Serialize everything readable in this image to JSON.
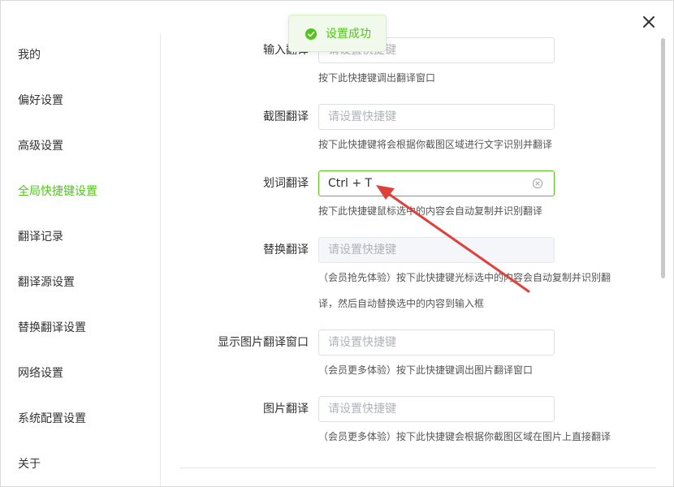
{
  "colors": {
    "accent": "#52c41a",
    "arrow": "#e0403a"
  },
  "sidebar": {
    "items": [
      {
        "label": "我的"
      },
      {
        "label": "偏好设置"
      },
      {
        "label": "高级设置"
      },
      {
        "label": "全局快捷键设置",
        "active": true
      },
      {
        "label": "翻译记录"
      },
      {
        "label": "翻译源设置"
      },
      {
        "label": "替换翻译设置"
      },
      {
        "label": "网络设置"
      },
      {
        "label": "系统配置设置"
      },
      {
        "label": "关于"
      }
    ]
  },
  "shortcuts": [
    {
      "label": "输入翻译",
      "value": "",
      "placeholder": "请设置快捷键",
      "hint": "按下此快捷键调出翻译窗口"
    },
    {
      "label": "截图翻译",
      "value": "",
      "placeholder": "请设置快捷键",
      "hint": "按下此快捷键将会根据你截图区域进行文字识别并翻译"
    },
    {
      "label": "划词翻译",
      "value": "Ctrl + T",
      "placeholder": "请设置快捷键",
      "hint": "按下此快捷键鼠标选中的内容会自动复制并识别翻译"
    },
    {
      "label": "替换翻译",
      "value": "",
      "placeholder": "请设置快捷键",
      "hint": "（会员抢先体验）按下此快捷键光标选中的内容会自动复制并识别翻",
      "hint2": "译，然后自动替换选中的内容到输入框"
    },
    {
      "label": "显示图片翻译窗口",
      "value": "",
      "placeholder": "请设置快捷键",
      "hint": "（会员更多体验）按下此快捷键调出图片翻译窗口"
    },
    {
      "label": "图片翻译",
      "value": "",
      "placeholder": "请设置快捷键",
      "hint": "（会员更多体验）按下此快捷键会根据你截图区域在图片上直接翻译"
    }
  ],
  "toast": {
    "text": "设置成功",
    "icon": "check-circle-icon"
  },
  "icons": {
    "close": "close-icon",
    "clear": "clear-circle-icon"
  }
}
